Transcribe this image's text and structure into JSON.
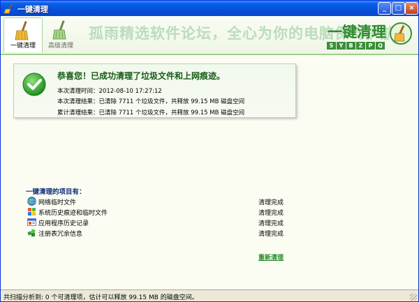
{
  "window": {
    "title": "一键清理",
    "minimize_glyph": "_",
    "maximize_glyph": "□",
    "close_glyph": "×"
  },
  "tabs": [
    {
      "label": "一键清理",
      "active": true,
      "icon": "broom-icon"
    },
    {
      "label": "高级清理",
      "active": false,
      "icon": "broom-icon"
    }
  ],
  "banner": {
    "slogan": "孤雨精选软件论坛，全心为你的电脑保驾护航",
    "logo_text": "一键清理",
    "logo_letters": [
      "S",
      "Y",
      "B",
      "Z",
      "P",
      "Q"
    ]
  },
  "result": {
    "title": "恭喜您！已成功清理了垃圾文件和上网痕迹。",
    "time_line": "本次清理时间：2012-08-10 17:27:12",
    "result_line": "本次清理结果：已清除 7711 个垃圾文件，共释放 99.15 MB 磁盘空间",
    "total_line": "累计清理结果：已清除 7711 个垃圾文件，共释放 99.15 MB 磁盘空间"
  },
  "items": {
    "title": "一键清理的项目有：",
    "list": [
      {
        "label": "网络临时文件",
        "status": "清理完成",
        "icon": "globe-icon"
      },
      {
        "label": "系统历史痕迹和临时文件",
        "status": "清理完成",
        "icon": "windows-icon"
      },
      {
        "label": "应用程序历史记录",
        "status": "清理完成",
        "icon": "app-window-icon"
      },
      {
        "label": "注册表冗余信息",
        "status": "清理完成",
        "icon": "registry-icon"
      }
    ]
  },
  "actions": {
    "reclean": "重新清理"
  },
  "status": {
    "text": "共扫描分析到: 0 个可清理项，估计可以释放 99.15 MB 的磁盘空间。"
  },
  "colors": {
    "titlebar": "#0550dc",
    "accent_green": "#2c8a2c",
    "panel_bg": "#f1f8ec"
  }
}
